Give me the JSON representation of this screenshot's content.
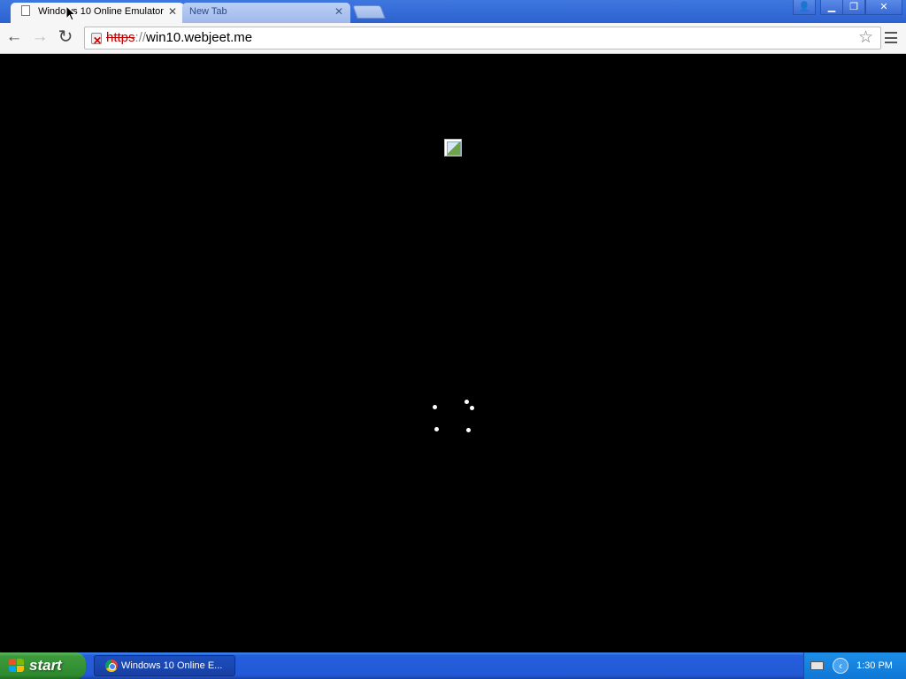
{
  "browser": {
    "tabs": [
      {
        "title": "Windows 10 Online Emulator",
        "active": true
      },
      {
        "title": "New Tab",
        "active": false
      }
    ],
    "tab_close_glyph": "✕",
    "window_controls": {
      "user": "👤",
      "minimize": "▁",
      "maximize": "❐",
      "close": "✕"
    },
    "nav": {
      "back": "←",
      "forward": "→",
      "reload": "↻"
    },
    "address": {
      "scheme": "https",
      "separator": "://",
      "host": "win10.webjeet.me"
    },
    "star_glyph": "☆"
  },
  "taskbar": {
    "start_label": "start",
    "task_button_label": "Windows 10 Online E...",
    "clock": "1:30 PM",
    "tray_chevron": "‹",
    "colors": {
      "flag_red": "#f25022",
      "flag_green": "#7fba00",
      "flag_blue": "#00a4ef",
      "flag_yellow": "#ffb900"
    }
  },
  "icons": [
    "page-icon",
    "close-icon",
    "new-tab-icon",
    "back-icon",
    "forward-icon",
    "reload-icon",
    "lock-icon",
    "star-icon",
    "menu-icon",
    "broken-image-icon",
    "windows-flag-icon",
    "chrome-icon",
    "keyboard-icon",
    "tray-chevron-icon"
  ]
}
